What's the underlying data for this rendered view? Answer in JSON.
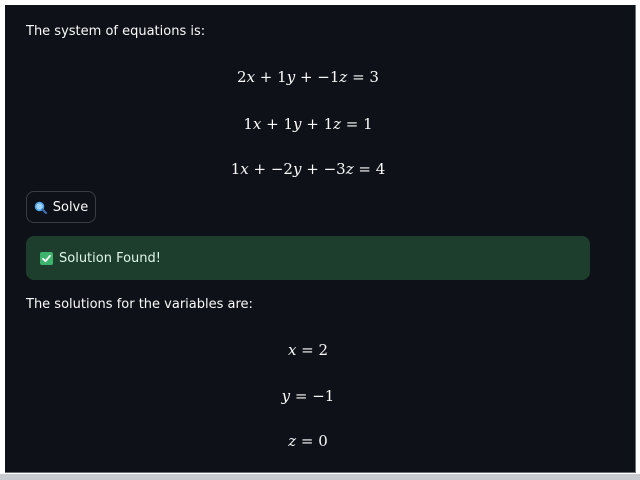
{
  "intro_text": "The system of equations is:",
  "equations": [
    {
      "a": "2",
      "b": "1",
      "c": "−1",
      "rhs": "3",
      "op1": "+",
      "op2": "+",
      "sign_c": "−",
      "sign_b": "",
      "b_val": "1",
      "c_val": "1"
    },
    {
      "a": "1",
      "b": "1",
      "c": "1",
      "rhs": "1"
    },
    {
      "a": "1",
      "b": "−2",
      "c": "−3",
      "rhs": "4"
    }
  ],
  "solve_button": {
    "label": "Solve",
    "icon": "magnifier-icon"
  },
  "status": {
    "label": "Solution Found!",
    "icon": "check-box-icon"
  },
  "solutions_text": "The solutions for the variables are:",
  "solutions": [
    {
      "var": "x",
      "value": "2"
    },
    {
      "var": "y",
      "value": "−1"
    },
    {
      "var": "z",
      "value": "0"
    }
  ],
  "colors": {
    "background": "#0e1117",
    "text": "#fafafa",
    "success_bg": "#1d3e2d",
    "success_icon": "#3db46d"
  }
}
